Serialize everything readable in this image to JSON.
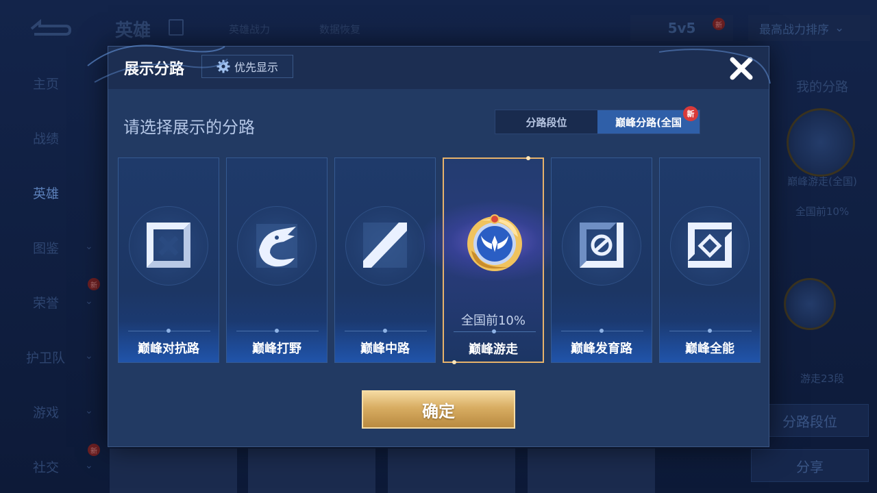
{
  "background": {
    "title": "英雄",
    "tabs": [
      "英雄战力",
      "数据恢复"
    ],
    "mode": "5v5",
    "new_badge": "新",
    "sort_label": "最高战力排序",
    "sidebar": [
      {
        "label": "主页",
        "chevron": false,
        "new": false
      },
      {
        "label": "战绩",
        "chevron": false,
        "new": false
      },
      {
        "label": "英雄",
        "chevron": false,
        "new": false,
        "active": true
      },
      {
        "label": "图鉴",
        "chevron": true,
        "new": false
      },
      {
        "label": "荣誉",
        "chevron": true,
        "new": true
      },
      {
        "label": "护卫队",
        "chevron": true,
        "new": false
      },
      {
        "label": "游戏",
        "chevron": true,
        "new": false
      },
      {
        "label": "社交",
        "chevron": true,
        "new": true
      }
    ],
    "right_panel": {
      "my_lane_title": "我的分路",
      "lane_name": "巅峰游走(全国)",
      "lane_rank": "全国前10%",
      "lane_level": "游走23段",
      "lane_rank_button": "分路段位",
      "share_button": "分享"
    }
  },
  "modal": {
    "title": "展示分路",
    "priority_button": "优先显示",
    "prompt": "请选择展示的分路",
    "segment_tabs": [
      {
        "label": "分路段位",
        "active": false
      },
      {
        "label": "巅峰分路(全国",
        "active": true,
        "new_badge": "新"
      }
    ],
    "lanes": [
      {
        "label": "巅峰对抗路",
        "icon": "sword-clash-icon",
        "rank": "",
        "selected": false
      },
      {
        "label": "巅峰打野",
        "icon": "dragon-icon",
        "rank": "",
        "selected": false
      },
      {
        "label": "巅峰中路",
        "icon": "mid-lane-icon",
        "rank": "",
        "selected": false
      },
      {
        "label": "巅峰游走",
        "icon": "support-emblem-icon",
        "rank": "全国前10%",
        "selected": true
      },
      {
        "label": "巅峰发育路",
        "icon": "marksman-lane-icon",
        "rank": "",
        "selected": false
      },
      {
        "label": "巅峰全能",
        "icon": "all-round-icon",
        "rank": "",
        "selected": false
      }
    ],
    "confirm_button": "确定"
  },
  "colors": {
    "modal_bg": "#22365c",
    "accent_blue": "#2f5fa8",
    "selected_border": "#e8b36b",
    "confirm_gold": "#d8ad62",
    "badge_red": "#d83a3a"
  }
}
